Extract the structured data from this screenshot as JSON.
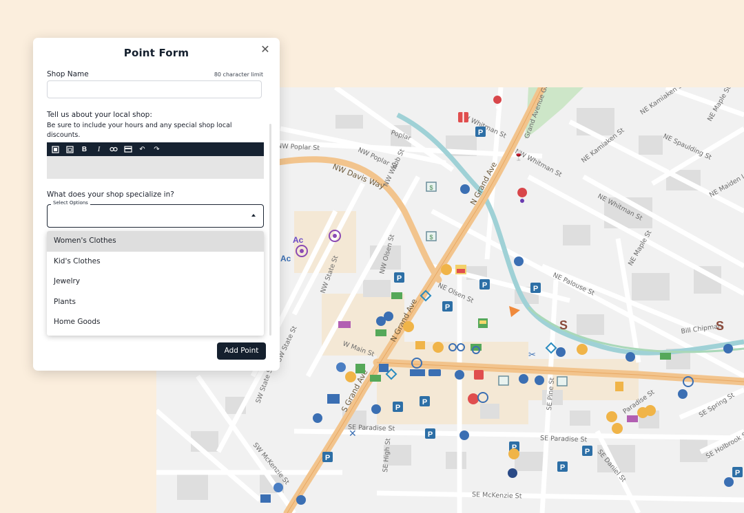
{
  "form": {
    "title": "Point Form",
    "shop_name_label": "Shop Name",
    "char_limit": "80 character limit",
    "shop_name_value": "",
    "about_label": "Tell us about your local shop:",
    "about_help": "Be sure to include your hours and any special shop local discounts.",
    "toolbar_buttons": [
      "copy-icon",
      "paste-icon",
      "bold-icon",
      "italic-icon",
      "link-icon",
      "image-icon",
      "undo-icon",
      "redo-icon"
    ],
    "specialize_label": "What does your shop specialize in?",
    "select_legend": "Select Options",
    "select_value": "",
    "options": [
      "Women's Clothes",
      "Kid's Clothes",
      "Jewelry",
      "Plants",
      "Home Goods"
    ],
    "highlighted_option": "Women's Clothes",
    "submit_label": "Add Point"
  },
  "map": {
    "streets": [
      "NW Davis Way",
      "N Grand Ave",
      "NW Poplar St",
      "Poplar",
      "NW Poplar St",
      "NW Whitman St",
      "Grand Avenue Greenway",
      "NE Kamiaken St",
      "NE Spaulding St",
      "NE Whitman St",
      "NE Maple St",
      "NE Maiden Ln",
      "NE Palouse St",
      "NE Olsen St",
      "NW Olsen St",
      "NW State St",
      "N Grand Ave",
      "S Grand Ave",
      "SE Paradise St",
      "SE Paradise St",
      "Paradise St",
      "SW McKenzie St",
      "SE McKenzie St",
      "SE High St",
      "SE Pine St",
      "SE Daniel St",
      "SE Spring St",
      "SE Holbrook St",
      "NW State St",
      "W Main St",
      "NE Kamiaken St",
      "Bill Chipman",
      "NW Webb St",
      "SW State St",
      "NE Maple St",
      "NE Kamiaken St",
      "NE Maple St"
    ]
  }
}
